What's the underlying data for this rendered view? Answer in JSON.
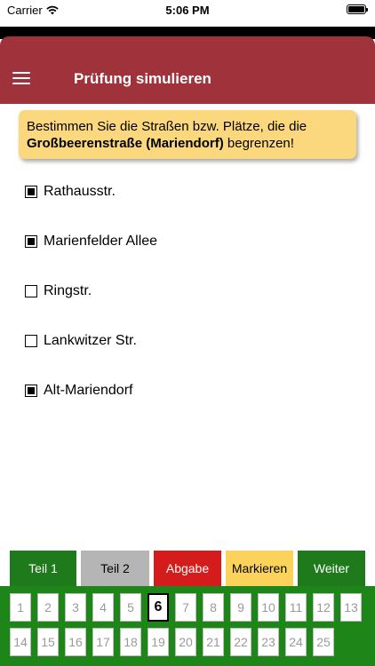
{
  "status_bar": {
    "carrier": "Carrier",
    "time": "5:06 PM"
  },
  "header": {
    "title": "Prüfung simulieren"
  },
  "question": {
    "prefix": "Bestimmen Sie die Straßen bzw. Plätze, die die ",
    "highlight": "Großbeerenstraße (Mariendorf)",
    "suffix": " begrenzen!"
  },
  "answers": [
    {
      "label": "Rathausstr.",
      "checked": true
    },
    {
      "label": "Marienfelder Allee",
      "checked": true
    },
    {
      "label": "Ringstr.",
      "checked": false
    },
    {
      "label": "Lankwitzer Str.",
      "checked": false
    },
    {
      "label": "Alt-Mariendorf",
      "checked": true
    }
  ],
  "tabs": [
    {
      "label": "Teil 1",
      "color": "#1e7a1a",
      "text_color": "#ffffff"
    },
    {
      "label": "Teil 2",
      "color": "#b5b5b5",
      "text_color": "#000000"
    },
    {
      "label": "Abgabe",
      "color": "#d41c1c",
      "text_color": "#ffffff"
    },
    {
      "label": "Markieren",
      "color": "#fbd35a",
      "text_color": "#000000"
    },
    {
      "label": "Weiter",
      "color": "#1e7a1a",
      "text_color": "#ffffff"
    }
  ],
  "question_numbers": [
    "1",
    "2",
    "3",
    "4",
    "5",
    "6",
    "7",
    "8",
    "9",
    "10",
    "11",
    "12",
    "13",
    "14",
    "15",
    "16",
    "17",
    "18",
    "19",
    "20",
    "21",
    "22",
    "23",
    "24",
    "25"
  ],
  "current_question": "6",
  "colors": {
    "header": "#a0323c",
    "question_bg": "#fbd77d",
    "grid_bg": "#1e8519"
  }
}
